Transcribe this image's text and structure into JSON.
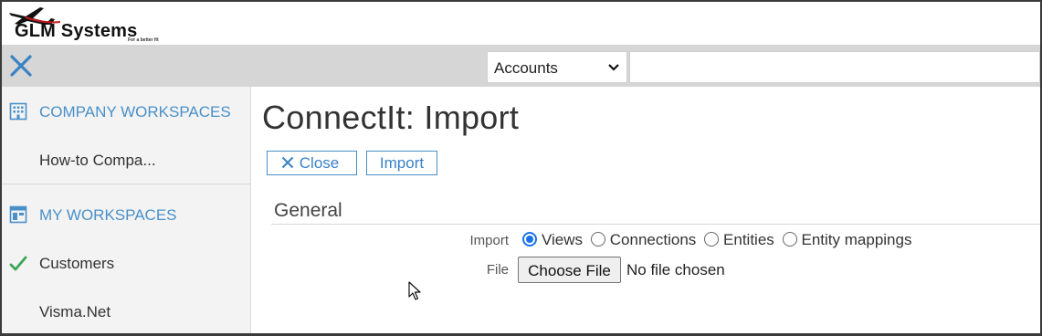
{
  "brand": {
    "name": "GLM Systems",
    "tagline": "For a better fit"
  },
  "toolbar": {
    "close_icon": "close-icon",
    "selected_entity": "Accounts",
    "search_value": ""
  },
  "sidebar": {
    "sections": [
      {
        "icon": "building-icon",
        "label": "COMPANY WORKSPACES",
        "items": [
          {
            "label": "How-to Compa...",
            "checked": false
          }
        ]
      },
      {
        "icon": "window-icon",
        "label": "MY WORKSPACES",
        "items": [
          {
            "label": "Customers",
            "checked": true
          },
          {
            "label": "Visma.Net",
            "checked": false
          }
        ]
      }
    ]
  },
  "main": {
    "title": "ConnectIt: Import",
    "buttons": {
      "close_label": "Close",
      "import_label": "Import"
    },
    "section_title": "General",
    "form": {
      "import_label": "Import",
      "options": [
        {
          "label": "Views",
          "checked": true
        },
        {
          "label": "Connections",
          "checked": false
        },
        {
          "label": "Entities",
          "checked": false
        },
        {
          "label": "Entity mappings",
          "checked": false
        }
      ],
      "file_label": "File",
      "file_button": "Choose File",
      "file_status": "No file chosen"
    }
  },
  "colors": {
    "accent": "#4a90c8",
    "toolbar_bg": "#d6d6d6",
    "sidebar_bg": "#f3f3f3",
    "check_green": "#3aa655",
    "radio_blue": "#1a73e8"
  }
}
